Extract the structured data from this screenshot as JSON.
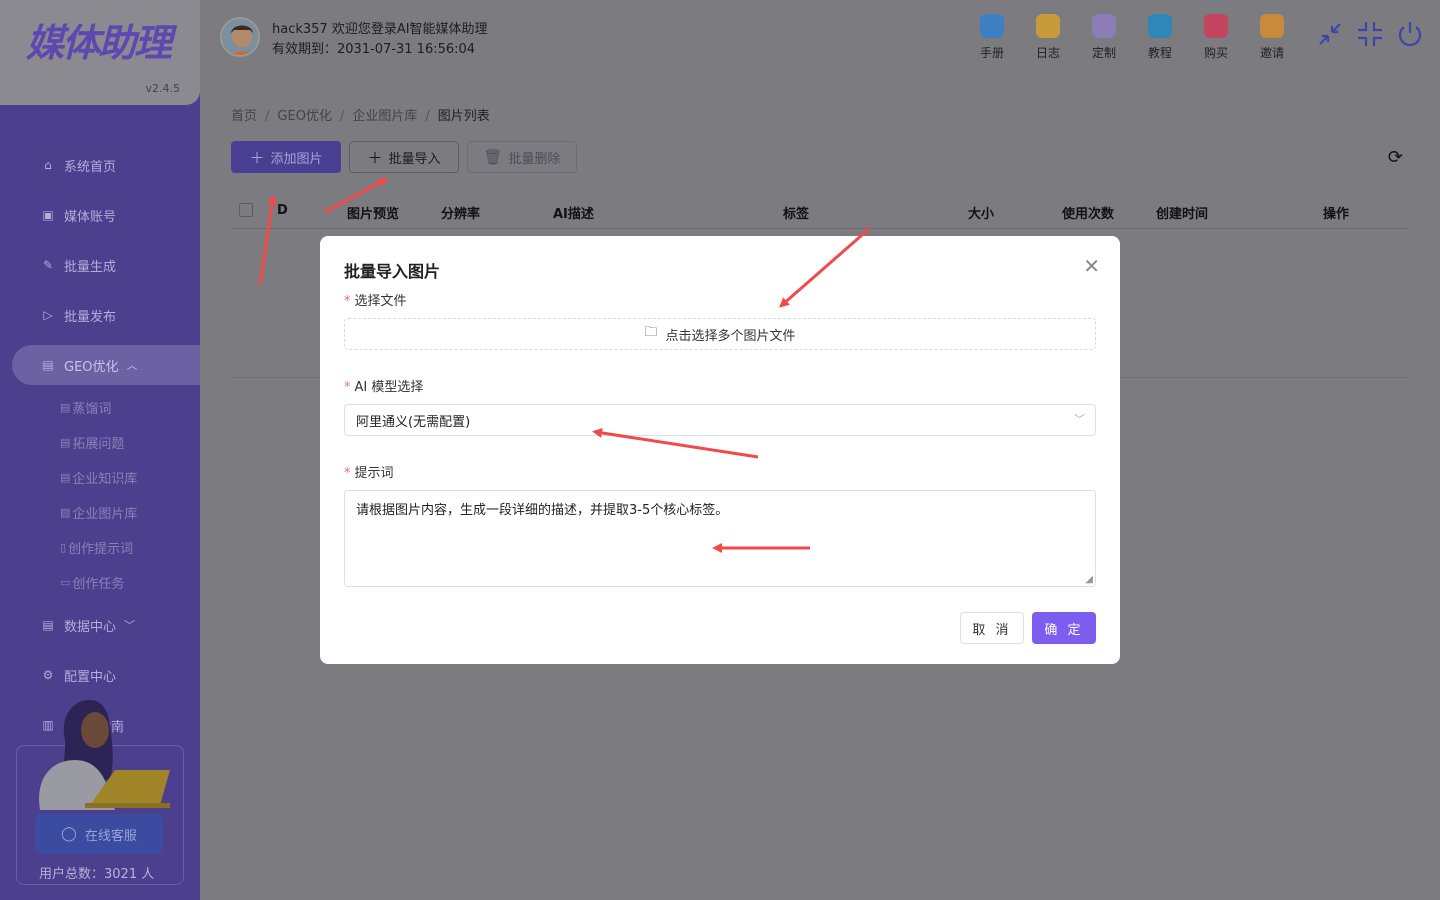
{
  "app": {
    "logo_text": "媒体助理",
    "version": "v2.4.5"
  },
  "header": {
    "user_line1": "hack357 欢迎您登录AI智能媒体助理",
    "user_line2": "有效期到：2031-07-31 16:56:04",
    "quick_links": [
      {
        "label": "手册",
        "icon": "manual-icon",
        "color": "#3c7fc2"
      },
      {
        "label": "日志",
        "icon": "log-icon",
        "color": "#c79a3a"
      },
      {
        "label": "定制",
        "icon": "custom-icon",
        "color": "#8c7cb8"
      },
      {
        "label": "教程",
        "icon": "tutorial-icon",
        "color": "#2f86b8"
      },
      {
        "label": "购买",
        "icon": "buy-icon",
        "color": "#c2445e"
      },
      {
        "label": "邀请",
        "icon": "invite-icon",
        "color": "#c98a3c"
      }
    ]
  },
  "sidebar": {
    "items": [
      {
        "label": "系统首页",
        "icon": "home-icon"
      },
      {
        "label": "媒体账号",
        "icon": "account-icon"
      },
      {
        "label": "批量生成",
        "icon": "edit-icon"
      },
      {
        "label": "批量发布",
        "icon": "send-icon"
      },
      {
        "label": "GEO优化",
        "icon": "list-icon"
      },
      {
        "label": "数据中心",
        "icon": "data-icon"
      },
      {
        "label": "配置中心",
        "icon": "gear-icon"
      },
      {
        "label": "指南",
        "icon": "book-icon"
      }
    ],
    "geo_sub": [
      {
        "label": "蒸馏词"
      },
      {
        "label": "拓展问题"
      },
      {
        "label": "企业知识库"
      },
      {
        "label": "企业图片库"
      },
      {
        "label": "创作提示词"
      },
      {
        "label": "创作任务"
      }
    ],
    "support_button": "在线客服",
    "user_count": "用户总数：3021 人"
  },
  "breadcrumb": [
    "首页",
    "GEO优化",
    "企业图片库",
    "图片列表"
  ],
  "toolbar": {
    "add_label": "添加图片",
    "import_label": "批量导入",
    "delete_label": "批量删除"
  },
  "table": {
    "columns": [
      "D",
      "图片预览",
      "分辨率",
      "AI描述",
      "标签",
      "大小",
      "使用次数",
      "创建时间",
      "操作"
    ]
  },
  "dialog": {
    "title": "批量导入图片",
    "file_label": "选择文件",
    "file_placeholder": "点击选择多个图片文件",
    "model_label": "AI 模型选择",
    "model_value": "阿里通义(无需配置)",
    "prompt_label": "提示词",
    "prompt_value": "请根据图片内容，生成一段详细的描述，并提取3-5个核心标签。",
    "cancel_label": "取 消",
    "ok_label": "确 定"
  },
  "colors": {
    "primary": "#7b5ef0",
    "sidebar": "#4b3f8e",
    "required": "#f56c6c",
    "annotation": "#f04a4a"
  }
}
